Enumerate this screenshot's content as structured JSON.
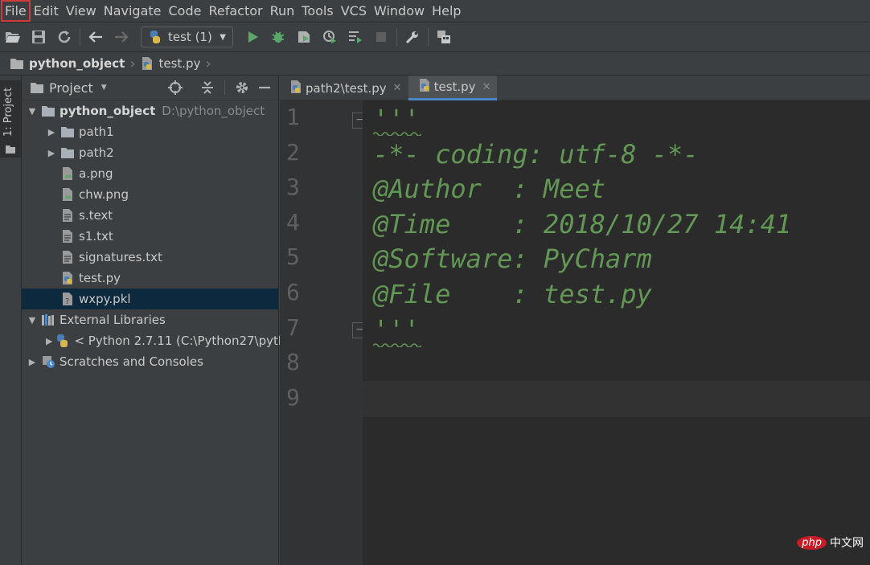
{
  "menu": [
    "File",
    "Edit",
    "View",
    "Navigate",
    "Code",
    "Refactor",
    "Run",
    "Tools",
    "VCS",
    "Window",
    "Help"
  ],
  "toolbar": {
    "run_config": "test (1)"
  },
  "breadcrumb": {
    "project": "python_object",
    "file": "test.py"
  },
  "side_tab": {
    "label": "1: Project"
  },
  "project_panel": {
    "title": "Project",
    "tree": [
      {
        "name": "python_object",
        "path": "D:\\python_object",
        "icon": "folder-icon",
        "level": 0,
        "expanded": true
      },
      {
        "name": "path1",
        "icon": "folder-icon",
        "level": 1,
        "expanded": false
      },
      {
        "name": "path2",
        "icon": "folder-icon",
        "level": 1,
        "expanded": false
      },
      {
        "name": "a.png",
        "icon": "image-file-icon",
        "level": 1
      },
      {
        "name": "chw.png",
        "icon": "image-file-icon",
        "level": 1
      },
      {
        "name": "s.text",
        "icon": "text-file-icon",
        "level": 1
      },
      {
        "name": "s1.txt",
        "icon": "text-file-icon",
        "level": 1
      },
      {
        "name": "signatures.txt",
        "icon": "text-file-icon",
        "level": 1
      },
      {
        "name": "test.py",
        "icon": "python-file-icon",
        "level": 1
      },
      {
        "name": "wxpy.pkl",
        "icon": "unknown-file-icon",
        "level": 1,
        "selected": true
      },
      {
        "name": "External Libraries",
        "icon": "libraries-icon",
        "level": 0,
        "expanded": true
      },
      {
        "name": "< Python 2.7.11 (C:\\Python27\\pyth",
        "icon": "python-sdk-icon",
        "level": 1,
        "expanded": false
      },
      {
        "name": "Scratches and Consoles",
        "icon": "scratches-icon",
        "level": 0,
        "expanded": false
      }
    ]
  },
  "editor": {
    "tabs": [
      {
        "label": "path2\\test.py",
        "active": false
      },
      {
        "label": "test.py",
        "active": true
      }
    ],
    "line_numbers": [
      "1",
      "2",
      "3",
      "4",
      "5",
      "6",
      "7",
      "8",
      "9"
    ],
    "lines": [
      "'''",
      "-*- coding: utf-8 -*-",
      "@Author  : Meet",
      "@Time    : 2018/10/27 14:41",
      "@Software: PyCharm",
      "@File    : test.py",
      "'''",
      "",
      ""
    ]
  },
  "watermark": {
    "logo": "php",
    "text": "中文网"
  },
  "colors": {
    "docstring": "#629755",
    "selection": "#0d293e",
    "accent": "#4a88c7",
    "highlight": "#d33a3a"
  }
}
